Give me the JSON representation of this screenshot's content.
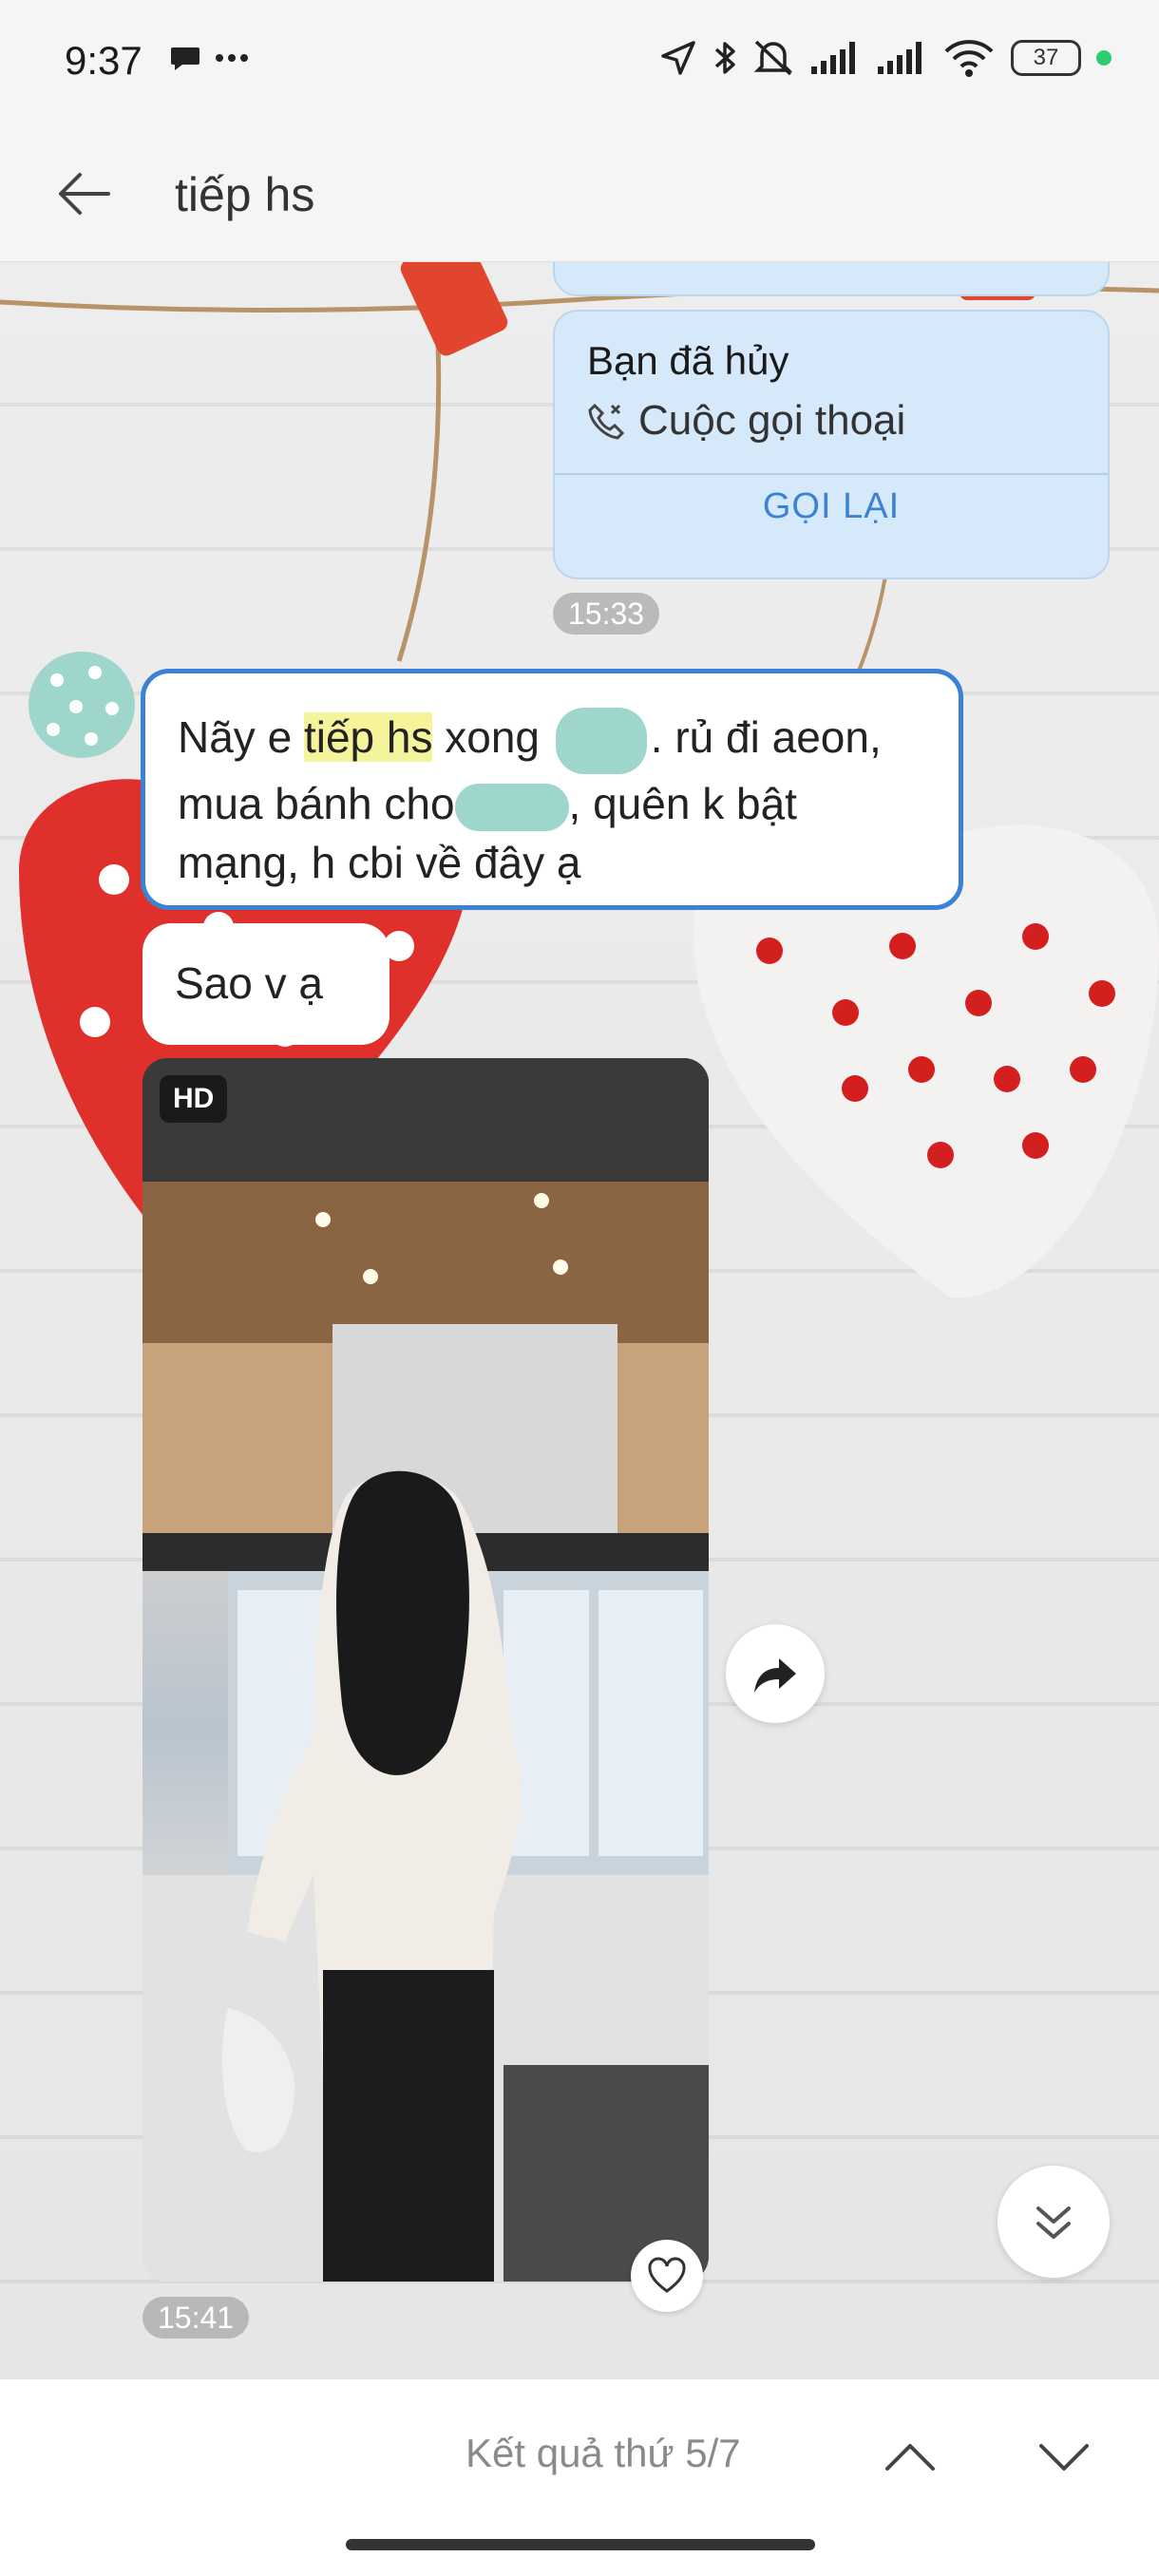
{
  "status_bar": {
    "time": "9:37",
    "battery": "37"
  },
  "header": {
    "title": "tiếp hs"
  },
  "call_card": {
    "title": "Bạn đã hủy",
    "subtitle": "Cuộc gọi thoại",
    "action": "GỌI LẠI",
    "time": "15:33"
  },
  "messages": {
    "highlighted": {
      "part1": "Nãy e ",
      "match": "tiếp hs",
      "part2": " xong ",
      "part3": ". rủ đi aeon, mua bánh cho",
      "part4": ", quên k bật mạng, h cbi về đây ạ"
    },
    "simple": "Sao v ạ",
    "photo_badge": "HD",
    "photo_time": "15:41"
  },
  "search_results": {
    "text": "Kết quả thứ 5/7"
  },
  "colors": {
    "accent": "#3b82d6",
    "highlight": "#f6f49a",
    "call_card_bg": "#d6e9fb",
    "avatar": "#9fd6cc"
  }
}
